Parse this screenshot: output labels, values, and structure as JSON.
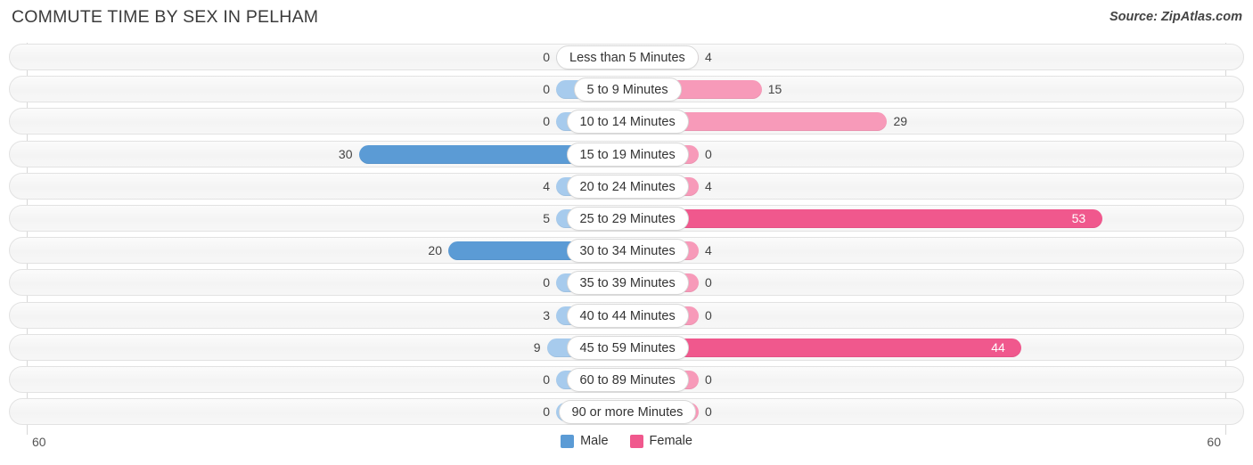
{
  "header": {
    "title": "COMMUTE TIME BY SEX IN PELHAM",
    "source": "Source: ZipAtlas.com"
  },
  "legend": {
    "male_label": "Male",
    "female_label": "Female",
    "male_color": "#5b9bd5",
    "female_color": "#f0588d"
  },
  "axis": {
    "left_min_label": "60",
    "right_min_label": "60",
    "max": 60
  },
  "colors": {
    "male_light": "#a7cbed",
    "male_strong": "#5b9bd5",
    "female_light": "#f79ab9",
    "female_strong": "#f0588d",
    "track": "#f6f6f6",
    "gridline": "#d7d7d7"
  },
  "chart_data": {
    "type": "bar",
    "orientation": "horizontal",
    "style": "diverging-bidirectional",
    "title": "COMMUTE TIME BY SEX IN PELHAM",
    "xlabel": "",
    "ylabel": "",
    "xlim": [
      60,
      60
    ],
    "grid": true,
    "legend_position": "bottom-center",
    "categories": [
      "Less than 5 Minutes",
      "5 to 9 Minutes",
      "10 to 14 Minutes",
      "15 to 19 Minutes",
      "20 to 24 Minutes",
      "25 to 29 Minutes",
      "30 to 34 Minutes",
      "35 to 39 Minutes",
      "40 to 44 Minutes",
      "45 to 59 Minutes",
      "60 to 89 Minutes",
      "90 or more Minutes"
    ],
    "series": [
      {
        "name": "Male",
        "color": "#5b9bd5",
        "direction": "left",
        "values": [
          0,
          0,
          0,
          30,
          4,
          5,
          20,
          0,
          3,
          9,
          0,
          0
        ]
      },
      {
        "name": "Female",
        "color": "#f0588d",
        "direction": "right",
        "values": [
          4,
          15,
          29,
          0,
          4,
          53,
          4,
          0,
          0,
          44,
          0,
          0
        ]
      }
    ]
  },
  "rows": [
    {
      "label": "Less than 5 Minutes",
      "male": 0,
      "male_text": "0",
      "female": 4,
      "female_text": "4"
    },
    {
      "label": "5 to 9 Minutes",
      "male": 0,
      "male_text": "0",
      "female": 15,
      "female_text": "15"
    },
    {
      "label": "10 to 14 Minutes",
      "male": 0,
      "male_text": "0",
      "female": 29,
      "female_text": "29"
    },
    {
      "label": "15 to 19 Minutes",
      "male": 30,
      "male_text": "30",
      "female": 0,
      "female_text": "0"
    },
    {
      "label": "20 to 24 Minutes",
      "male": 4,
      "male_text": "4",
      "female": 4,
      "female_text": "4"
    },
    {
      "label": "25 to 29 Minutes",
      "male": 5,
      "male_text": "5",
      "female": 53,
      "female_text": "53"
    },
    {
      "label": "30 to 34 Minutes",
      "male": 20,
      "male_text": "20",
      "female": 4,
      "female_text": "4"
    },
    {
      "label": "35 to 39 Minutes",
      "male": 0,
      "male_text": "0",
      "female": 0,
      "female_text": "0"
    },
    {
      "label": "40 to 44 Minutes",
      "male": 3,
      "male_text": "3",
      "female": 0,
      "female_text": "0"
    },
    {
      "label": "45 to 59 Minutes",
      "male": 9,
      "male_text": "9",
      "female": 44,
      "female_text": "44"
    },
    {
      "label": "60 to 89 Minutes",
      "male": 0,
      "male_text": "0",
      "female": 0,
      "female_text": "0"
    },
    {
      "label": "90 or more Minutes",
      "male": 0,
      "male_text": "0",
      "female": 0,
      "female_text": "0"
    }
  ]
}
